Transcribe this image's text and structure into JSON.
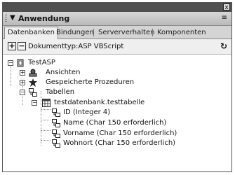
{
  "panel": {
    "title": "Anwendung",
    "close_label": "x",
    "menu_label": "≡"
  },
  "tabs": [
    {
      "label": "Datenbanken",
      "active": true
    },
    {
      "label": "Bindungen",
      "active": false
    },
    {
      "label": "Serververhalten",
      "active": false
    },
    {
      "label": "Komponenten",
      "active": false
    }
  ],
  "toolbar": {
    "add_label": "+",
    "remove_label": "−",
    "doctype": "Dokumenttyp:ASP VBScript",
    "refresh_label": "C"
  },
  "tree": {
    "root": "TestASP",
    "ansichten": "Ansichten",
    "prozeduren": "Gespeicherte Prozeduren",
    "tabellen": "Tabellen",
    "table": "testdatenbank.testtabelle",
    "columns": [
      "ID (Integer 4)",
      "Name (Char 150 erforderlich)",
      "Vorname (Char 150 erforderlich)",
      "Wohnort (Char 150 erforderlich)"
    ]
  }
}
